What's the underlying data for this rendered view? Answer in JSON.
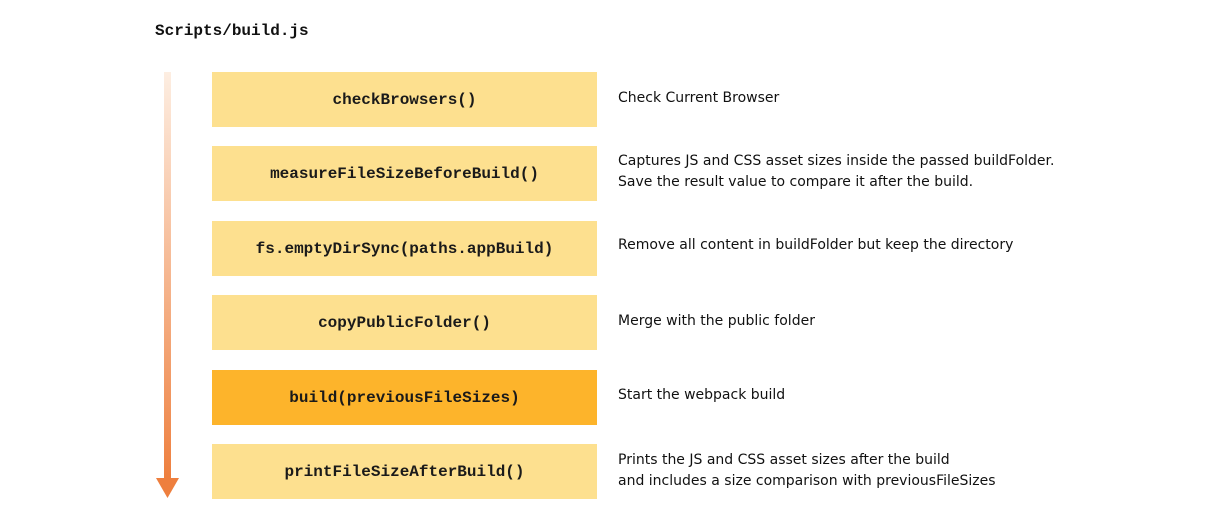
{
  "title": "Scripts/build.js",
  "colors": {
    "step_fill": "#fde08f",
    "step_fill_highlight": "#fdb42b",
    "arrow_top": "#fdeee2",
    "arrow_bottom": "#ee7f3e"
  },
  "steps": [
    {
      "fn": "checkBrowsers()",
      "highlight": false,
      "desc": [
        "Check Current Browser"
      ]
    },
    {
      "fn": "measureFileSizeBeforeBuild()",
      "highlight": false,
      "desc": [
        "Captures JS and CSS asset sizes inside the passed buildFolder.",
        "Save the result value to compare it after the build."
      ]
    },
    {
      "fn": "fs.emptyDirSync(paths.appBuild)",
      "highlight": false,
      "desc": [
        "Remove all content in buildFolder but keep the directory"
      ]
    },
    {
      "fn": "copyPublicFolder()",
      "highlight": false,
      "desc": [
        "Merge with the public folder"
      ]
    },
    {
      "fn": "build(previousFileSizes)",
      "highlight": true,
      "desc": [
        "Start the webpack build"
      ]
    },
    {
      "fn": "printFileSizeAfterBuild()",
      "highlight": false,
      "desc": [
        "Prints the JS and CSS asset sizes after the build",
        "and includes a size comparison with previousFileSizes"
      ]
    }
  ]
}
